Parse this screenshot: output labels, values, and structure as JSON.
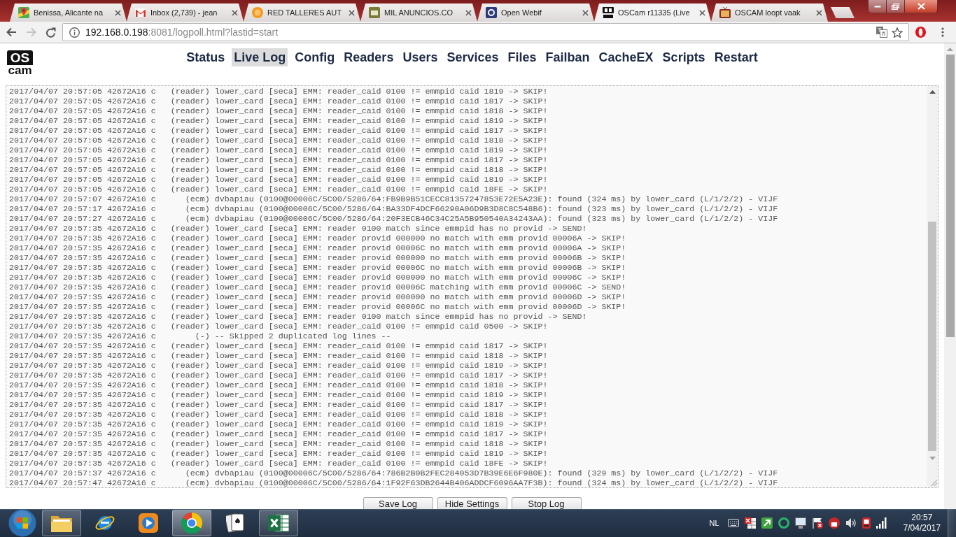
{
  "browser": {
    "tabs": [
      {
        "label": "Benissa, Alicante na",
        "selected": false
      },
      {
        "label": "Inbox (2,739) - jean",
        "selected": false
      },
      {
        "label": "RED TALLERES AUT",
        "selected": false
      },
      {
        "label": "MIL ANUNCIOS.CO",
        "selected": false
      },
      {
        "label": "Open Webif",
        "selected": false
      },
      {
        "label": "OSCam r11335 (Live",
        "selected": true
      },
      {
        "label": "OSCAM loopt vaak",
        "selected": false
      }
    ],
    "address": {
      "host": "192.168.0.198",
      "path": ":8081/logpoll.html?lastid=start"
    }
  },
  "page": {
    "logo": {
      "top": "OS",
      "bottom": "cam"
    },
    "menu": [
      {
        "label": "Status",
        "selected": false
      },
      {
        "label": "Live Log",
        "selected": true
      },
      {
        "label": "Config",
        "selected": false
      },
      {
        "label": "Readers",
        "selected": false
      },
      {
        "label": "Users",
        "selected": false
      },
      {
        "label": "Services",
        "selected": false
      },
      {
        "label": "Files",
        "selected": false
      },
      {
        "label": "Failban",
        "selected": false
      },
      {
        "label": "CacheEX",
        "selected": false
      },
      {
        "label": "Scripts",
        "selected": false
      },
      {
        "label": "Restart",
        "selected": false
      }
    ],
    "log": {
      "lines": [
        "2017/04/07 20:57:05 42672A16 c   (reader) lower_card [seca] EMM: reader_caid 0100 != emmpid caid 1819 -> SKIP!",
        "2017/04/07 20:57:05 42672A16 c   (reader) lower_card [seca] EMM: reader_caid 0100 != emmpid caid 1817 -> SKIP!",
        "2017/04/07 20:57:05 42672A16 c   (reader) lower_card [seca] EMM: reader_caid 0100 != emmpid caid 1818 -> SKIP!",
        "2017/04/07 20:57:05 42672A16 c   (reader) lower_card [seca] EMM: reader_caid 0100 != emmpid caid 1819 -> SKIP!",
        "2017/04/07 20:57:05 42672A16 c   (reader) lower_card [seca] EMM: reader_caid 0100 != emmpid caid 1817 -> SKIP!",
        "2017/04/07 20:57:05 42672A16 c   (reader) lower_card [seca] EMM: reader_caid 0100 != emmpid caid 1818 -> SKIP!",
        "2017/04/07 20:57:05 42672A16 c   (reader) lower_card [seca] EMM: reader_caid 0100 != emmpid caid 1819 -> SKIP!",
        "2017/04/07 20:57:05 42672A16 c   (reader) lower_card [seca] EMM: reader_caid 0100 != emmpid caid 1817 -> SKIP!",
        "2017/04/07 20:57:05 42672A16 c   (reader) lower_card [seca] EMM: reader_caid 0100 != emmpid caid 1818 -> SKIP!",
        "2017/04/07 20:57:05 42672A16 c   (reader) lower_card [seca] EMM: reader_caid 0100 != emmpid caid 1819 -> SKIP!",
        "2017/04/07 20:57:05 42672A16 c   (reader) lower_card [seca] EMM: reader_caid 0100 != emmpid caid 18FE -> SKIP!",
        "2017/04/07 20:57:07 42672A16 c      (ecm) dvbapiau (0100@00006C/5C00/5286/64:FB9B9B51CECC81357247853E72E5A23E): found (324 ms) by lower_card (L/1/2/2) - VIJF",
        "2017/04/07 20:57:17 42672A16 c      (ecm) dvbapiau (0100@00006C/5C00/5286/64:BA33DF4DCF66290A06D9B3D8C8C548B6): found (323 ms) by lower_card (L/1/2/2) - VIJF",
        "2017/04/07 20:57:27 42672A16 c      (ecm) dvbapiau (0100@00006C/5C00/5286/64:20F3ECB46C34C25A5B950540A34243AA): found (323 ms) by lower_card (L/1/2/2) - VIJF",
        "2017/04/07 20:57:35 42672A16 c   (reader) lower_card [seca] EMM: reader 0100 match since emmpid has no provid -> SEND!",
        "2017/04/07 20:57:35 42672A16 c   (reader) lower_card [seca] EMM: reader provid 000000 no match with emm provid 00006A -> SKIP!",
        "2017/04/07 20:57:35 42672A16 c   (reader) lower_card [seca] EMM: reader provid 00006C no match with emm provid 00006A -> SKIP!",
        "2017/04/07 20:57:35 42672A16 c   (reader) lower_card [seca] EMM: reader provid 000000 no match with emm provid 00006B -> SKIP!",
        "2017/04/07 20:57:35 42672A16 c   (reader) lower_card [seca] EMM: reader provid 00006C no match with emm provid 00006B -> SKIP!",
        "2017/04/07 20:57:35 42672A16 c   (reader) lower_card [seca] EMM: reader provid 000000 no match with emm provid 00006C -> SKIP!",
        "2017/04/07 20:57:35 42672A16 c   (reader) lower_card [seca] EMM: reader provid 00006C matching with emm provid 00006C -> SEND!",
        "2017/04/07 20:57:35 42672A16 c   (reader) lower_card [seca] EMM: reader provid 000000 no match with emm provid 00006D -> SKIP!",
        "2017/04/07 20:57:35 42672A16 c   (reader) lower_card [seca] EMM: reader provid 00006C no match with emm provid 00006D -> SKIP!",
        "2017/04/07 20:57:35 42672A16 c   (reader) lower_card [seca] EMM: reader 0100 match since emmpid has no provid -> SEND!",
        "2017/04/07 20:57:35 42672A16 c   (reader) lower_card [seca] EMM: reader_caid 0100 != emmpid caid 0500 -> SKIP!",
        "2017/04/07 20:57:35 42672A16 c        (-) -- Skipped 2 duplicated log lines --",
        "2017/04/07 20:57:35 42672A16 c   (reader) lower_card [seca] EMM: reader_caid 0100 != emmpid caid 1817 -> SKIP!",
        "2017/04/07 20:57:35 42672A16 c   (reader) lower_card [seca] EMM: reader_caid 0100 != emmpid caid 1818 -> SKIP!",
        "2017/04/07 20:57:35 42672A16 c   (reader) lower_card [seca] EMM: reader_caid 0100 != emmpid caid 1819 -> SKIP!",
        "2017/04/07 20:57:35 42672A16 c   (reader) lower_card [seca] EMM: reader_caid 0100 != emmpid caid 1817 -> SKIP!",
        "2017/04/07 20:57:35 42672A16 c   (reader) lower_card [seca] EMM: reader_caid 0100 != emmpid caid 1818 -> SKIP!",
        "2017/04/07 20:57:35 42672A16 c   (reader) lower_card [seca] EMM: reader_caid 0100 != emmpid caid 1819 -> SKIP!",
        "2017/04/07 20:57:35 42672A16 c   (reader) lower_card [seca] EMM: reader_caid 0100 != emmpid caid 1817 -> SKIP!",
        "2017/04/07 20:57:35 42672A16 c   (reader) lower_card [seca] EMM: reader_caid 0100 != emmpid caid 1818 -> SKIP!",
        "2017/04/07 20:57:35 42672A16 c   (reader) lower_card [seca] EMM: reader_caid 0100 != emmpid caid 1819 -> SKIP!",
        "2017/04/07 20:57:35 42672A16 c   (reader) lower_card [seca] EMM: reader_caid 0100 != emmpid caid 1817 -> SKIP!",
        "2017/04/07 20:57:35 42672A16 c   (reader) lower_card [seca] EMM: reader_caid 0100 != emmpid caid 1818 -> SKIP!",
        "2017/04/07 20:57:35 42672A16 c   (reader) lower_card [seca] EMM: reader_caid 0100 != emmpid caid 1819 -> SKIP!",
        "2017/04/07 20:57:35 42672A16 c   (reader) lower_card [seca] EMM: reader_caid 0100 != emmpid caid 18FE -> SKIP!",
        "2017/04/07 20:57:37 42672A16 c      (ecm) dvbapiau (0100@00006C/5C00/5286/64:786B2B0B2FEC284053D7B39E6E6F980E): found (329 ms) by lower_card (L/1/2/2) - VIJF",
        "2017/04/07 20:57:47 42672A16 c      (ecm) dvbapiau (0100@00006C/5C00/5286/64:1F92F63DB2644B406ADDCF6096AA7F3B): found (324 ms) by lower_card (L/1/2/2) - VIJF"
      ]
    },
    "buttons": [
      "Save Log",
      "Hide Settings",
      "Stop Log"
    ]
  },
  "taskbar": {
    "apps": [
      {
        "running": true,
        "selected": false
      },
      {
        "running": false,
        "selected": false
      },
      {
        "running": false,
        "selected": false
      },
      {
        "running": true,
        "selected": true
      },
      {
        "running": false,
        "selected": false
      },
      {
        "running": true,
        "selected": false
      }
    ],
    "language": "NL",
    "clock": {
      "time": "20:57",
      "date": "7/04/2017"
    }
  }
}
